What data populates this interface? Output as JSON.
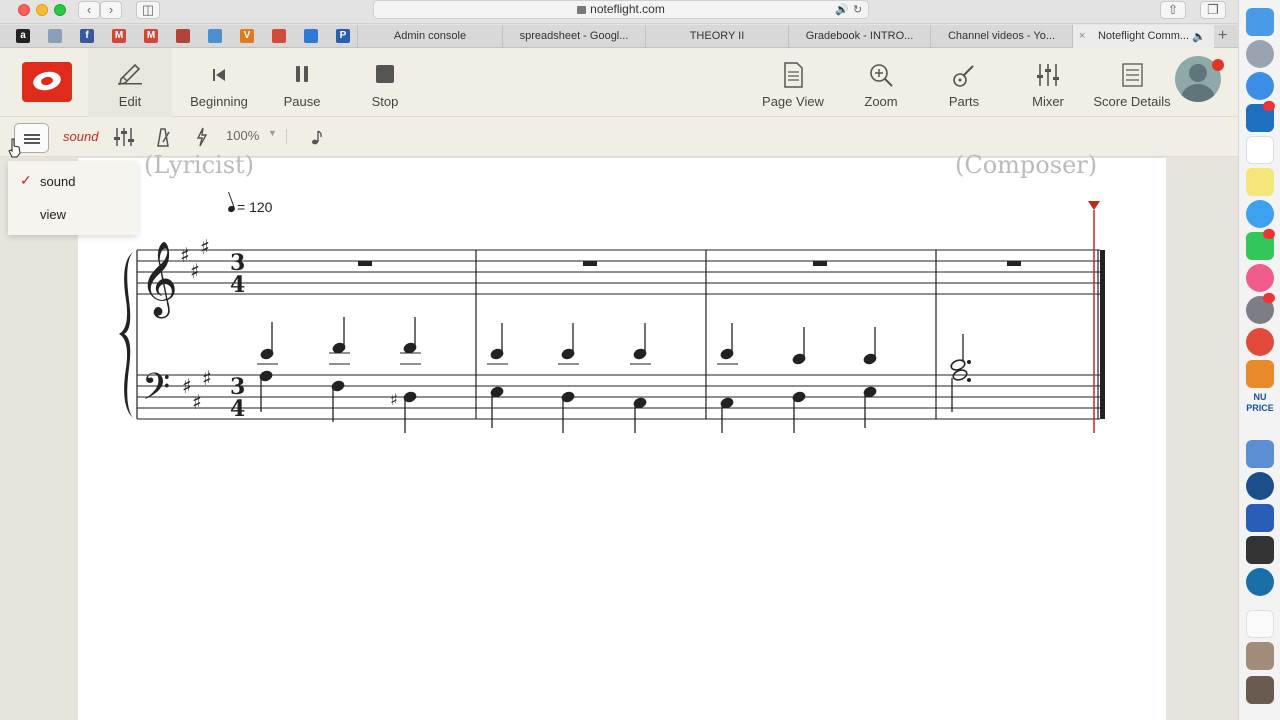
{
  "browser": {
    "url": "noteflight.com",
    "bookmarks": [
      {
        "name": "amazon-favicon",
        "glyph": "a",
        "color": "#222222"
      },
      {
        "name": "globe-favicon",
        "glyph": "",
        "color": "#8aa0b8"
      },
      {
        "name": "facebook-favicon",
        "glyph": "f",
        "color": "#3b5998"
      },
      {
        "name": "gmail-favicon",
        "glyph": "M",
        "color": "#d14836"
      },
      {
        "name": "gmail-favicon-2",
        "glyph": "M",
        "color": "#d14836"
      },
      {
        "name": "book-favicon",
        "glyph": "",
        "color": "#b0443a"
      },
      {
        "name": "chart-favicon",
        "glyph": "",
        "color": "#4c8fd0"
      },
      {
        "name": "v-favicon",
        "glyph": "V",
        "color": "#e07a1c"
      },
      {
        "name": "sun-favicon",
        "glyph": "",
        "color": "#d24b3a"
      },
      {
        "name": "cloud-favicon",
        "glyph": "",
        "color": "#2b7bd6"
      },
      {
        "name": "paypal-favicon",
        "glyph": "P",
        "color": "#2a5fb0"
      }
    ],
    "tabs": [
      {
        "label": "Admin console"
      },
      {
        "label": "spreadsheet - Googl..."
      },
      {
        "label": "THEORY II"
      },
      {
        "label": "Gradebook - INTRO..."
      },
      {
        "label": "Channel videos - Yo..."
      },
      {
        "label": "Noteflight Comm..."
      }
    ]
  },
  "toolbar": {
    "edit": "Edit",
    "beginning": "Beginning",
    "pause": "Pause",
    "stop": "Stop",
    "page_view": "Page View",
    "zoom": "Zoom",
    "parts": "Parts",
    "mixer": "Mixer",
    "score_details": "Score Details"
  },
  "subtoolbar": {
    "mode": "sound",
    "zoom": "100%"
  },
  "dropdown": {
    "items": [
      {
        "label": "sound",
        "checked": true
      },
      {
        "label": "view",
        "checked": false
      }
    ]
  },
  "score": {
    "lyricist": "(Lyricist)",
    "composer": "(Composer)",
    "tempo": "= 120",
    "time_signature": {
      "numerator": "3",
      "denominator": "4"
    },
    "key_signature": "3 sharps",
    "accent_color": "#c2281c"
  }
}
